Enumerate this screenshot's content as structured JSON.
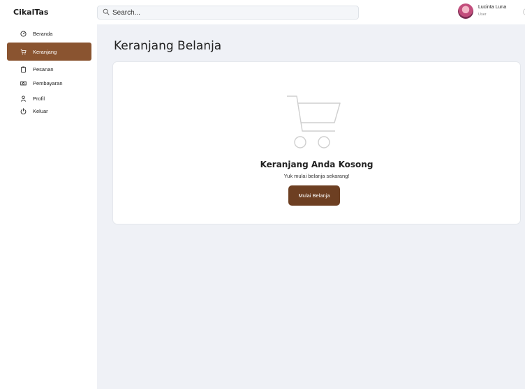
{
  "app": {
    "brand": "CikalTas"
  },
  "header": {
    "search_placeholder": "Search...",
    "user": {
      "name": "Lucinta Luna",
      "role": "User"
    }
  },
  "sidebar": {
    "items": [
      {
        "label": "Beranda",
        "icon": "dashboard-icon"
      },
      {
        "label": "Keranjang",
        "icon": "cart-icon",
        "active": true
      },
      {
        "label": "Pesanan",
        "icon": "clipboard-icon"
      },
      {
        "label": "Pembayaran",
        "icon": "cash-icon"
      },
      {
        "label": "Profil",
        "icon": "user-icon"
      },
      {
        "label": "Keluar",
        "icon": "power-icon"
      }
    ]
  },
  "main": {
    "title": "Keranjang Belanja",
    "empty_state": {
      "title": "Keranjang Anda Kosong",
      "subtitle": "Yuk mulai belanja sekarang!",
      "button_label": "Mulai Belanja"
    }
  },
  "colors": {
    "accent": "#8a5430",
    "button": "#6d3f22",
    "main_bg": "#eff1f6"
  }
}
